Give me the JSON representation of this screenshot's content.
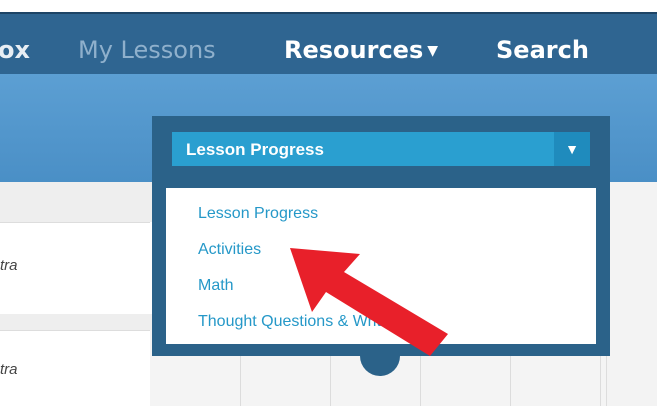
{
  "nav": {
    "inbox": "ox",
    "my_lessons": "My Lessons",
    "resources": "Resources",
    "resources_caret": "▼",
    "search": "Search"
  },
  "dropdown": {
    "selected": "Lesson Progress",
    "arrow": "▼",
    "options": [
      "Lesson Progress",
      "Activities",
      "Math",
      "Thought Questions & Writing"
    ]
  },
  "rows": [
    {
      "text": "tra"
    },
    {
      "text": "tra"
    }
  ],
  "colors": {
    "navbar": "#2f6591",
    "subbar": "#4a8fc6",
    "select": "#2a9fd0",
    "option_text": "#2598c8",
    "annotation_arrow": "#e8202a"
  },
  "icons": {
    "resources_caret": "caret-down-icon",
    "select_arrow": "chevron-down-icon",
    "annotation": "red-arrow-icon"
  }
}
